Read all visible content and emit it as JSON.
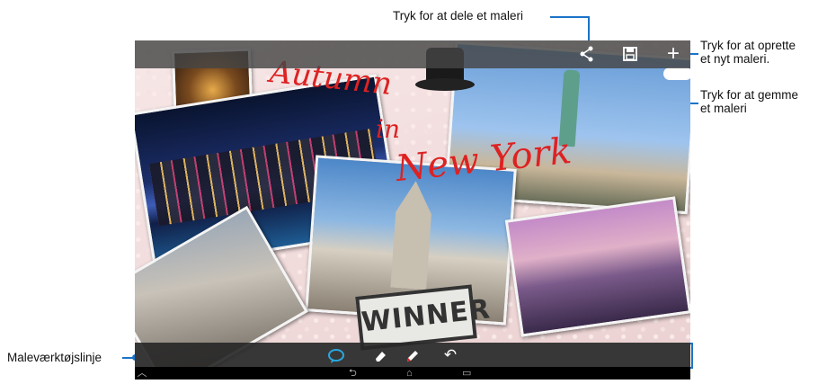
{
  "callouts": {
    "share": "Tryk for at dele et maleri",
    "create_line1": "Tryk for at oprette",
    "create_line2": "et nyt maleri.",
    "save_line1": "Tryk for at gemme",
    "save_line2": "et maleri",
    "toolbar": "Maleværktøjslinje"
  },
  "canvas": {
    "handwriting_1": "Autumn",
    "handwriting_2": "in",
    "handwriting_3": "New York",
    "sign_text": "WINNER"
  },
  "icons": {
    "share": "share-icon",
    "save": "save-icon",
    "add": "add-icon",
    "speech": "speech-bubble-icon",
    "eraser": "eraser-icon",
    "pen": "pen-icon",
    "undo": "undo-icon",
    "nav_up": "chevron-up-icon",
    "back": "back-icon",
    "home": "home-icon",
    "recent": "recent-apps-icon"
  },
  "colors": {
    "callout_line": "#1a73c8",
    "handwriting": "#d22222",
    "active_tool": "#29a8e0"
  }
}
